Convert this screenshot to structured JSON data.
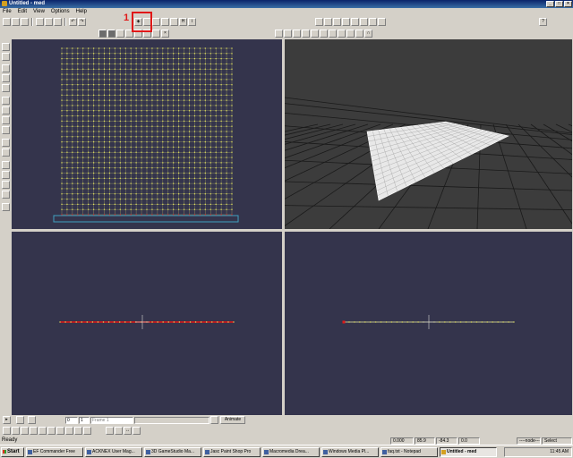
{
  "window": {
    "title": "Untitled - med"
  },
  "menu": [
    "File",
    "Edit",
    "View",
    "Options",
    "Help"
  ],
  "annotation": {
    "number": "1"
  },
  "frame_bar": {
    "start": "0",
    "end": "1",
    "frame_label": "Frame 1",
    "animate": "Animate"
  },
  "status": {
    "text": "Ready",
    "v1": "0.000",
    "v2": "85.9",
    "v3": "-84.3",
    "v4": "0.0",
    "mode": "----node----",
    "tool": "Select"
  },
  "taskbar": {
    "start": "Start",
    "tasks": [
      "EF Commander Free",
      "ACKNEX User Mag...",
      "3D GameStudio Ma...",
      "Jasc Paint Shop Pro",
      "Macromedia Drea...",
      "Windows Media Pl...",
      "faq.txt - Notepad",
      "Untitled - med"
    ],
    "clock": "11:45 AM"
  },
  "colors": {
    "viewport_bg": "#34344c",
    "grid_points": "#e8e860",
    "selection": "#e01818"
  }
}
